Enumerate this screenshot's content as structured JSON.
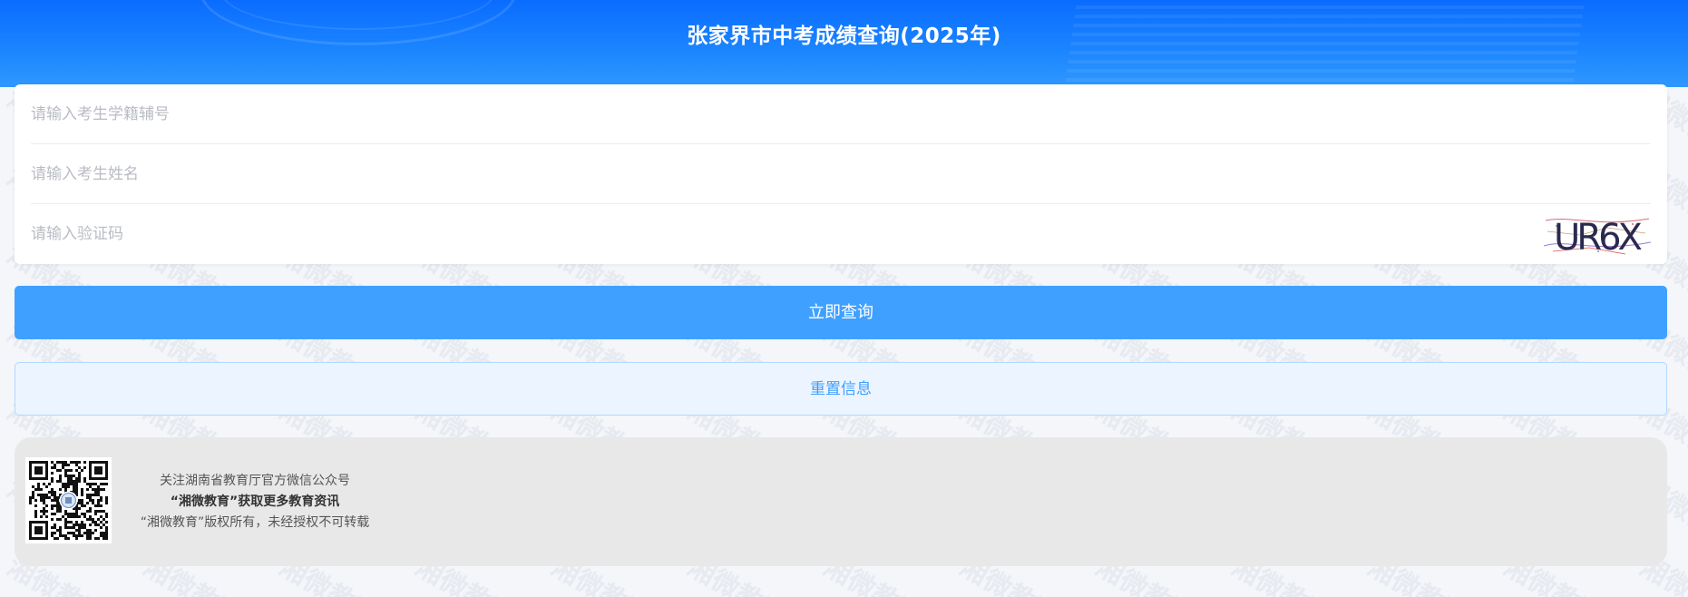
{
  "header": {
    "title": "张家界市中考成绩查询(2025年)"
  },
  "form": {
    "student_id_placeholder": "请输入考生学籍辅号",
    "name_placeholder": "请输入考生姓名",
    "captcha_placeholder": "请输入验证码",
    "captcha_text": "UR6X"
  },
  "buttons": {
    "query_label": "立即查询",
    "reset_label": "重置信息"
  },
  "footer": {
    "line1": "关注湖南省教育厅官方微信公众号",
    "line2": "“湘微教育”获取更多教育资讯",
    "line3": "“湘微教育”版权所有，未经授权不可转载"
  },
  "watermark_text": "湘微教育",
  "colors": {
    "header_blue": "#0a6cff",
    "query_button": "#40a0ff",
    "reset_background": "#ecf5ff",
    "reset_text": "#409eff",
    "page_background": "#f4f6fa",
    "footer_background": "#e8e8e8"
  },
  "icons": {
    "captcha": "captcha-image",
    "qr": "qr-code",
    "qr_center": "seal-emblem"
  }
}
